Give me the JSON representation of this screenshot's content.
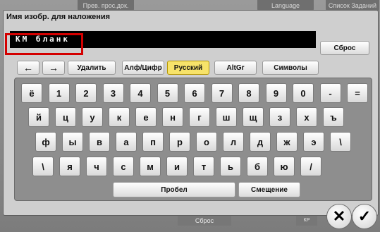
{
  "background": {
    "tabs": [
      "Прев. прос.док.",
      "Language",
      "Список Заданий"
    ],
    "bottom_left": "Сброс",
    "bottom_right": "КР"
  },
  "dialog": {
    "title": "Имя изобр. для наложения",
    "input_value": "КМ бланк",
    "reset_label": "Сброс"
  },
  "toolbar": {
    "left_arrow": "←",
    "right_arrow": "→",
    "delete_label": "Удалить",
    "alnum_label": "Алф/Цифр",
    "russian_label": "Русский",
    "altgr_label": "AltGr",
    "symbols_label": "Символы"
  },
  "keyboard": {
    "row1": [
      "ё",
      "1",
      "2",
      "3",
      "4",
      "5",
      "6",
      "7",
      "8",
      "9",
      "0",
      "-",
      "="
    ],
    "row2": [
      "й",
      "ц",
      "у",
      "к",
      "е",
      "н",
      "г",
      "ш",
      "щ",
      "з",
      "х",
      "ъ"
    ],
    "row3": [
      "ф",
      "ы",
      "в",
      "а",
      "п",
      "р",
      "о",
      "л",
      "д",
      "ж",
      "э",
      "\\"
    ],
    "row4": [
      "\\",
      "я",
      "ч",
      "с",
      "м",
      "и",
      "т",
      "ь",
      "б",
      "ю",
      "/"
    ],
    "space_label": "Пробел",
    "shift_label": "Смещение"
  },
  "actions": {
    "cancel_icon": "✕",
    "ok_icon": "✓"
  }
}
